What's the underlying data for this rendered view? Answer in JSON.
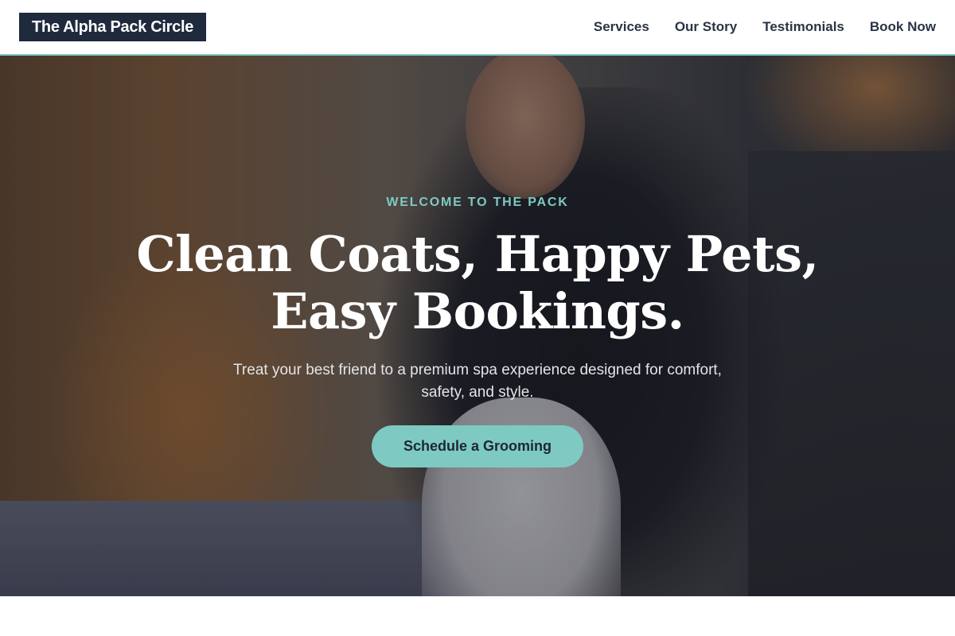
{
  "brand": {
    "name": "The Alpha Pack Circle"
  },
  "nav": {
    "items": [
      {
        "label": "Services"
      },
      {
        "label": "Our Story"
      },
      {
        "label": "Testimonials"
      },
      {
        "label": "Book Now"
      }
    ]
  },
  "hero": {
    "eyebrow": "WELCOME TO THE PACK",
    "headline_line1": "Clean Coats, Happy Pets,",
    "headline_line2": "Easy Bookings.",
    "subtext": "Treat your best friend to a premium spa experience designed for comfort, safety, and style.",
    "cta_label": "Schedule a Grooming"
  },
  "colors": {
    "accent": "#7ecac2",
    "brand_dark": "#1f2a3d",
    "nav_text": "#2b3445"
  }
}
